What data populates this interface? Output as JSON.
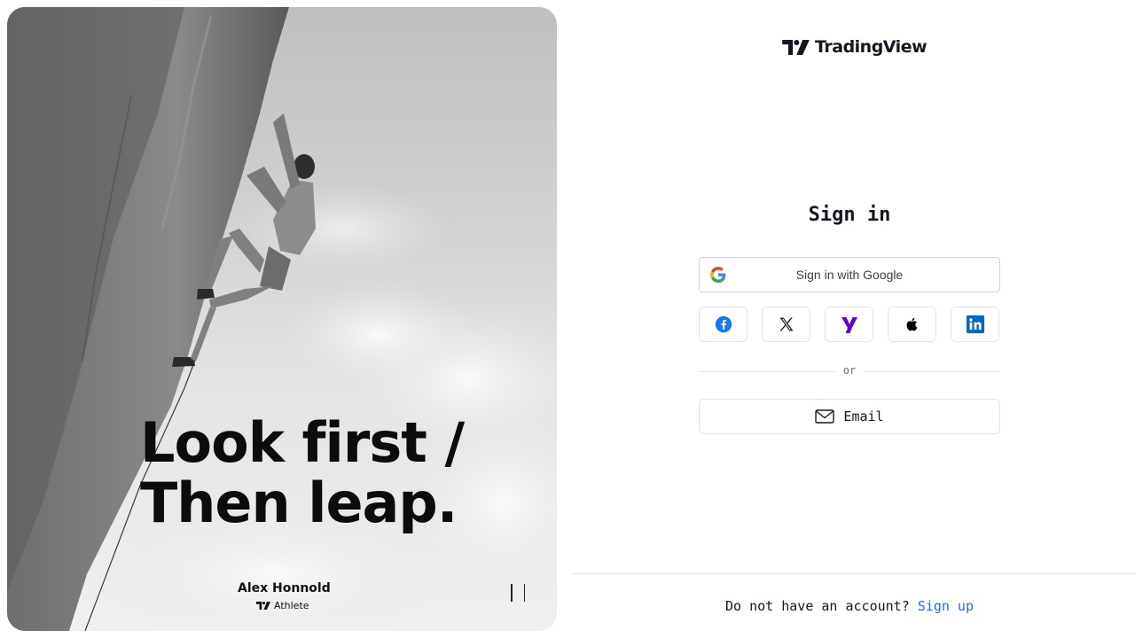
{
  "hero": {
    "headline_line1": "Look first /",
    "headline_line2": "Then leap.",
    "athlete_name": "Alex Honnold",
    "athlete_role": "Athlete",
    "image_subject": "rock-climber-photo"
  },
  "brand": {
    "name": "TradingView"
  },
  "signin": {
    "title": "Sign in",
    "google_label": "Sign in with Google",
    "social_providers": [
      "facebook-icon",
      "x-icon",
      "yahoo-icon",
      "apple-icon",
      "linkedin-icon"
    ],
    "divider_text": "or",
    "email_label": "Email"
  },
  "footer": {
    "prompt": "Do not have an account?",
    "signup_link": "Sign up"
  },
  "colors": {
    "link": "#2962ff",
    "facebook": "#1877f2",
    "yahoo": "#6001d2",
    "linkedin": "#0a66c2"
  }
}
